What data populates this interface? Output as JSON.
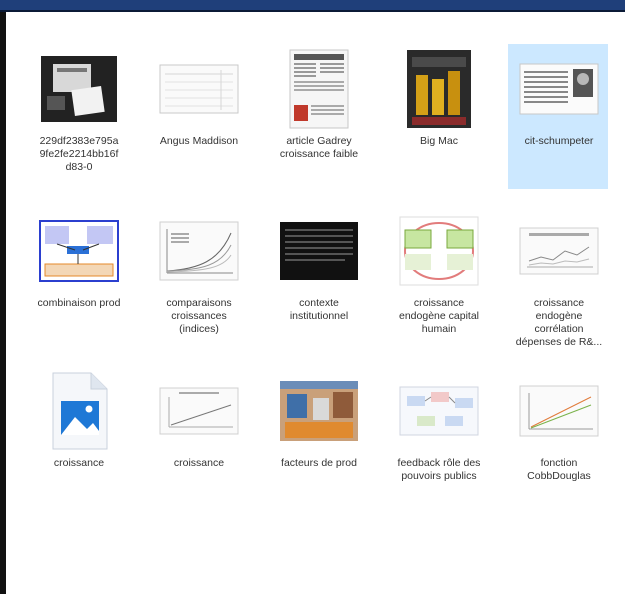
{
  "files": [
    {
      "label": "229df2383e795a9fe2fe2214bb16fd83-0",
      "display": "229df2383e795a\n9fe2fe2214bb16f\nd83-0",
      "icon": "image-thumbnail-icon",
      "selected": false
    },
    {
      "label": "Angus Maddison",
      "icon": "table-thumbnail-icon",
      "selected": false
    },
    {
      "label": "article Gadrey croissance faible",
      "icon": "document-thumbnail-icon",
      "selected": false
    },
    {
      "label": "Big Mac",
      "icon": "photo-thumbnail-icon",
      "selected": false
    },
    {
      "label": "cit-schumpeter",
      "icon": "quote-thumbnail-icon",
      "selected": true
    },
    {
      "label": "combinaison prod",
      "icon": "diagram-thumbnail-icon",
      "selected": false
    },
    {
      "label": "comparaisons croissances (indices)",
      "icon": "line-chart-thumbnail-icon",
      "selected": false
    },
    {
      "label": "contexte institutionnel",
      "icon": "dark-text-thumbnail-icon",
      "selected": false
    },
    {
      "label": "croissance endogène capital humain",
      "icon": "diagram-thumbnail-icon",
      "selected": false
    },
    {
      "label": "croissance endogène corrélation dépenses de R&...",
      "icon": "scatter-thumbnail-icon",
      "selected": false
    },
    {
      "label": "croissance",
      "icon": "image-file-icon",
      "selected": false
    },
    {
      "label": "croissance",
      "icon": "line-chart-thumbnail-icon",
      "selected": false
    },
    {
      "label": "facteurs de prod",
      "icon": "photo-thumbnail-icon",
      "selected": false
    },
    {
      "label": "feedback rôle des pouvoirs publics",
      "icon": "diagram-thumbnail-icon",
      "selected": false
    },
    {
      "label": "fonction CobbDouglas",
      "icon": "line-chart-thumbnail-icon",
      "selected": false
    }
  ],
  "colors": {
    "selection": "#cce8ff",
    "title_strip": "#1f3f7a",
    "accent_blue": "#1e78d6"
  }
}
